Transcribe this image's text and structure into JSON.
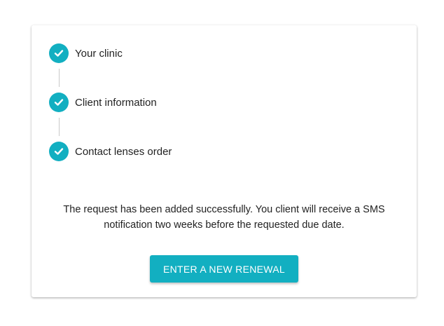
{
  "steps": [
    {
      "label": "Your clinic",
      "status": "complete",
      "icon": "check-icon"
    },
    {
      "label": "Client information",
      "status": "complete",
      "icon": "check-icon"
    },
    {
      "label": "Contact lenses order",
      "status": "complete",
      "icon": "check-icon"
    }
  ],
  "message": {
    "line1": "The request has been added successfully. You client will receive a SMS",
    "line2": "notification two weeks before the requested due date."
  },
  "actions": {
    "renew_label": "ENTER A NEW RENEWAL"
  },
  "colors": {
    "accent": "#12afc1",
    "text": "#222222",
    "connector": "#c8c8c8"
  }
}
